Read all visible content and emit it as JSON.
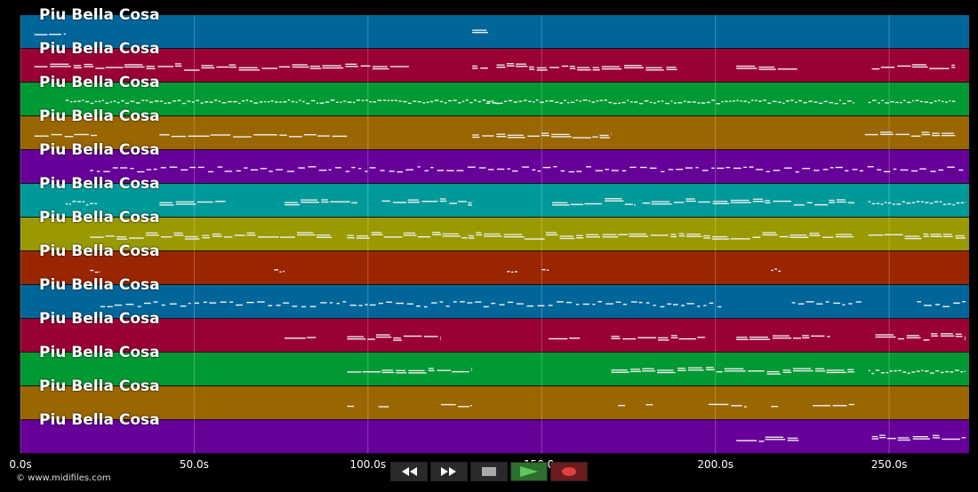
{
  "app": {
    "copyright": "© www.midifiles.com"
  },
  "transport": {
    "rewind_icon": "rewind-icon",
    "fast_forward_icon": "fast-forward-icon",
    "stop_icon": "stop-icon",
    "play_icon": "play-icon",
    "record_icon": "record-icon",
    "button_bg": "#2a2a2a",
    "play_bg": "#2e6e2e",
    "play_color": "#5cc85c",
    "record_bg": "#6b1c1c",
    "record_color": "#e04040"
  },
  "chart_data": {
    "type": "piano-roll",
    "x_unit": "s",
    "xlim": [
      0,
      273
    ],
    "x_ticks": [
      "0.0s",
      "50.0s",
      "100.0s",
      "150.0s",
      "200.0s",
      "250.0s"
    ],
    "x_tick_values": [
      0,
      50,
      100,
      150,
      200,
      250
    ],
    "grid": true,
    "tracks": [
      {
        "name": "Piu Bella Cosa",
        "color": "#006699",
        "segments": [
          [
            4,
            13,
            "chords"
          ],
          [
            130,
            135,
            "chords"
          ]
        ]
      },
      {
        "name": "Piu Bella Cosa",
        "color": "#990033",
        "segments": [
          [
            4,
            60,
            "chords"
          ],
          [
            60,
            112,
            "chords"
          ],
          [
            130,
            135,
            "chords"
          ],
          [
            137,
            189,
            "chords"
          ],
          [
            206,
            224,
            "chords"
          ],
          [
            245,
            269,
            "chords"
          ]
        ]
      },
      {
        "name": "Piu Bella Cosa",
        "color": "#009933",
        "segments": [
          [
            13,
            138,
            "dots"
          ],
          [
            134,
            240,
            "dots"
          ],
          [
            244,
            269,
            "dots"
          ]
        ]
      },
      {
        "name": "Piu Bella Cosa",
        "color": "#996600",
        "segments": [
          [
            4,
            22,
            "line"
          ],
          [
            40,
            94,
            "line"
          ],
          [
            130,
            170,
            "chords"
          ],
          [
            243,
            269,
            "chords"
          ]
        ]
      },
      {
        "name": "Piu Bella Cosa",
        "color": "#660099",
        "segments": [
          [
            20,
            272,
            "melody"
          ]
        ]
      },
      {
        "name": "Piu Bella Cosa",
        "color": "#009999",
        "segments": [
          [
            13,
            22,
            "dots"
          ],
          [
            40,
            59,
            "chords"
          ],
          [
            76,
            97,
            "chords"
          ],
          [
            104,
            130,
            "chords"
          ],
          [
            153,
            177,
            "chords"
          ],
          [
            179,
            240,
            "chords"
          ],
          [
            244,
            272,
            "dots"
          ]
        ]
      },
      {
        "name": "Piu Bella Cosa",
        "color": "#999900",
        "segments": [
          [
            20,
            90,
            "chords"
          ],
          [
            94,
            145,
            "chords"
          ],
          [
            145,
            172,
            "chords"
          ],
          [
            172,
            240,
            "chords"
          ],
          [
            244,
            272,
            "chords"
          ]
        ]
      },
      {
        "name": "Piu Bella Cosa",
        "color": "#992600",
        "segments": [
          [
            20,
            23,
            "dots"
          ],
          [
            73,
            76,
            "dots"
          ],
          [
            140,
            143,
            "dots"
          ],
          [
            150,
            152,
            "dots"
          ],
          [
            216,
            219,
            "dots"
          ]
        ]
      },
      {
        "name": "Piu Bella Cosa",
        "color": "#006699",
        "segments": [
          [
            23,
            202,
            "melody"
          ],
          [
            222,
            242,
            "melody"
          ],
          [
            258,
            272,
            "melody"
          ]
        ]
      },
      {
        "name": "Piu Bella Cosa",
        "color": "#990033",
        "segments": [
          [
            76,
            85,
            "line"
          ],
          [
            94,
            121,
            "chords"
          ],
          [
            152,
            161,
            "line"
          ],
          [
            170,
            197,
            "chords"
          ],
          [
            206,
            233,
            "chords"
          ],
          [
            246,
            272,
            "chords"
          ]
        ]
      },
      {
        "name": "Piu Bella Cosa",
        "color": "#009933",
        "segments": [
          [
            94,
            130,
            "chords"
          ],
          [
            170,
            240,
            "chords"
          ],
          [
            244,
            272,
            "dots"
          ]
        ]
      },
      {
        "name": "Piu Bella Cosa",
        "color": "#996600",
        "segments": [
          [
            94,
            96,
            "line"
          ],
          [
            103,
            106,
            "line"
          ],
          [
            121,
            130,
            "line"
          ],
          [
            172,
            174,
            "line"
          ],
          [
            180,
            182,
            "line"
          ],
          [
            198,
            209,
            "line"
          ],
          [
            216,
            218,
            "line"
          ],
          [
            228,
            240,
            "line"
          ]
        ]
      },
      {
        "name": "Piu Bella Cosa",
        "color": "#660099",
        "segments": [
          [
            206,
            224,
            "chords"
          ],
          [
            245,
            272,
            "chords"
          ]
        ]
      }
    ]
  }
}
